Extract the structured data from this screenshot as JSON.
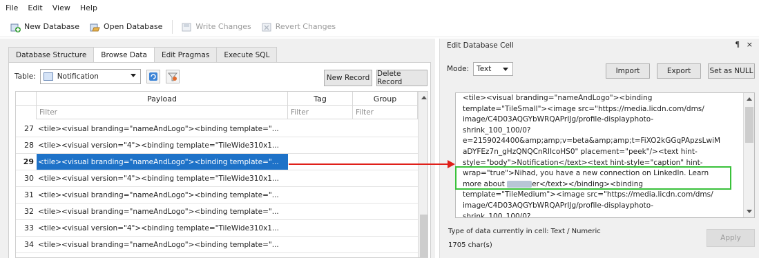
{
  "menu": [
    "File",
    "Edit",
    "View",
    "Help"
  ],
  "toolbar": {
    "new_db": "New Database",
    "open_db": "Open Database",
    "write": "Write Changes",
    "revert": "Revert Changes"
  },
  "tabs": [
    "Database Structure",
    "Browse Data",
    "Edit Pragmas",
    "Execute SQL"
  ],
  "browse": {
    "table_label": "Table:",
    "table_value": "Notification",
    "new_record": "New Record",
    "delete_record": "Delete Record"
  },
  "grid": {
    "columns": [
      "Payload",
      "Tag",
      "Group"
    ],
    "filter_placeholder": "Filter",
    "rows": [
      {
        "num": "27",
        "payload": "<tile><visual branding=\"nameAndLogo\"><binding template=\"..."
      },
      {
        "num": "28",
        "payload": "<tile><visual version=\"4\"><binding template=\"TileWide310x1..."
      },
      {
        "num": "29",
        "payload": "<tile><visual branding=\"nameAndLogo\"><binding template=\"...",
        "selected": true
      },
      {
        "num": "30",
        "payload": "<tile><visual version=\"4\"><binding template=\"TileWide310x1..."
      },
      {
        "num": "31",
        "payload": "<tile><visual branding=\"nameAndLogo\"><binding template=\"..."
      },
      {
        "num": "32",
        "payload": "<tile><visual branding=\"nameAndLogo\"><binding template=\"..."
      },
      {
        "num": "33",
        "payload": "<tile><visual version=\"4\"><binding template=\"TileWide310x1..."
      },
      {
        "num": "34",
        "payload": "<tile><visual branding=\"nameAndLogo\"><binding template=\"..."
      }
    ]
  },
  "editor": {
    "title": "Edit Database Cell",
    "window_controls": "¶ ×",
    "mode_label": "Mode:",
    "mode_value": "Text",
    "import": "Import",
    "export": "Export",
    "set_null": "Set as NULL",
    "lines": [
      "<tile><visual branding=\"nameAndLogo\"><binding",
      "template=\"TileSmall\"><image src=\"https://media.licdn.com/dms/",
      "image/C4D03AQGYbWRQAPrIJg/profile-displayphoto-",
      "shrink_100_100/0?",
      "e=2159024400&amp;amp;v=beta&amp;amp;t=FiXO2kGGqPApzsLwiM",
      "aDYFEz7n_gHzQNQCnRIIcoHS0\" placement=\"peek\"/><text hint-",
      "style=\"body\">Notification</text><text hint-style=\"caption\" hint-"
    ],
    "hl_line1": "wrap=\"true\">Nihad, you have a new connection on LinkedIn. Learn",
    "hl_line2_pre": "more about ",
    "hl_line2_post": "er</text></binding><binding",
    "lines_after": [
      "template=\"TileMedium\"><image src=\"https://media.licdn.com/dms/",
      "image/C4D03AQGYbWRQAPrIJg/profile-displayphoto-",
      "shrink_100_100/0?"
    ],
    "type_info": "Type of data currently in cell: Text / Numeric",
    "chars": "1705 char(s)",
    "apply": "Apply"
  },
  "colors": {
    "selection": "#1e72c8",
    "annotation_arrow": "#e0201a",
    "annotation_box": "#39c13a"
  }
}
